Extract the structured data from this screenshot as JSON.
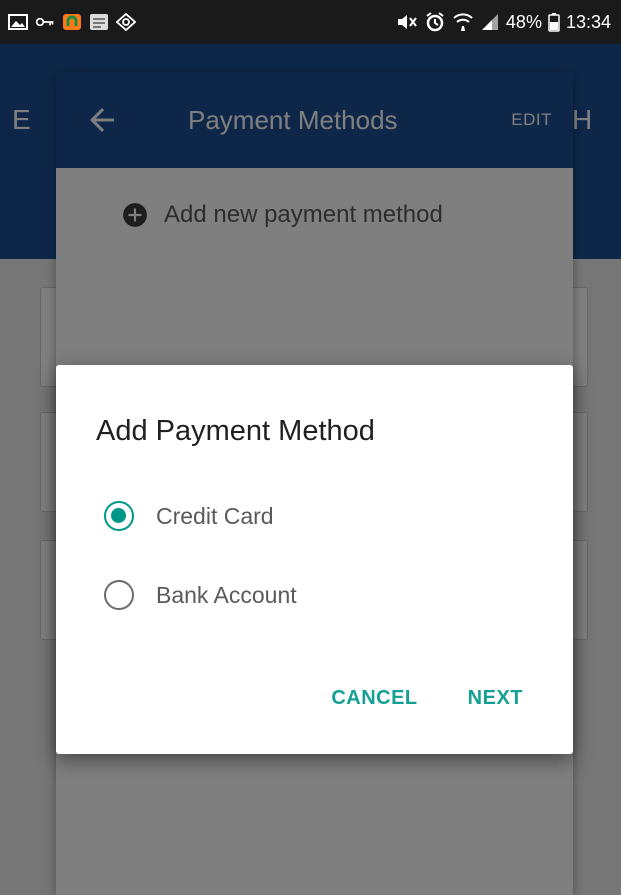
{
  "status_bar": {
    "battery": "48%",
    "time": "13:34",
    "icons_left": [
      "gallery-icon",
      "key-icon",
      "vpn-icon",
      "message-icon",
      "android-icon"
    ],
    "icons_right": [
      "mute-icon",
      "alarm-icon",
      "wifi-calling-icon",
      "signal-icon",
      "battery-icon"
    ]
  },
  "payment_methods_screen": {
    "title": "Payment Methods",
    "edit_label": "EDIT",
    "add_new_label": "Add new payment method",
    "appbar_color": "#1d4f91"
  },
  "dialog": {
    "title": "Add Payment Method",
    "options": [
      {
        "label": "Credit Card",
        "selected": true
      },
      {
        "label": "Bank Account",
        "selected": false
      }
    ],
    "cancel_label": "CANCEL",
    "next_label": "NEXT",
    "accent_color": "#009688"
  }
}
